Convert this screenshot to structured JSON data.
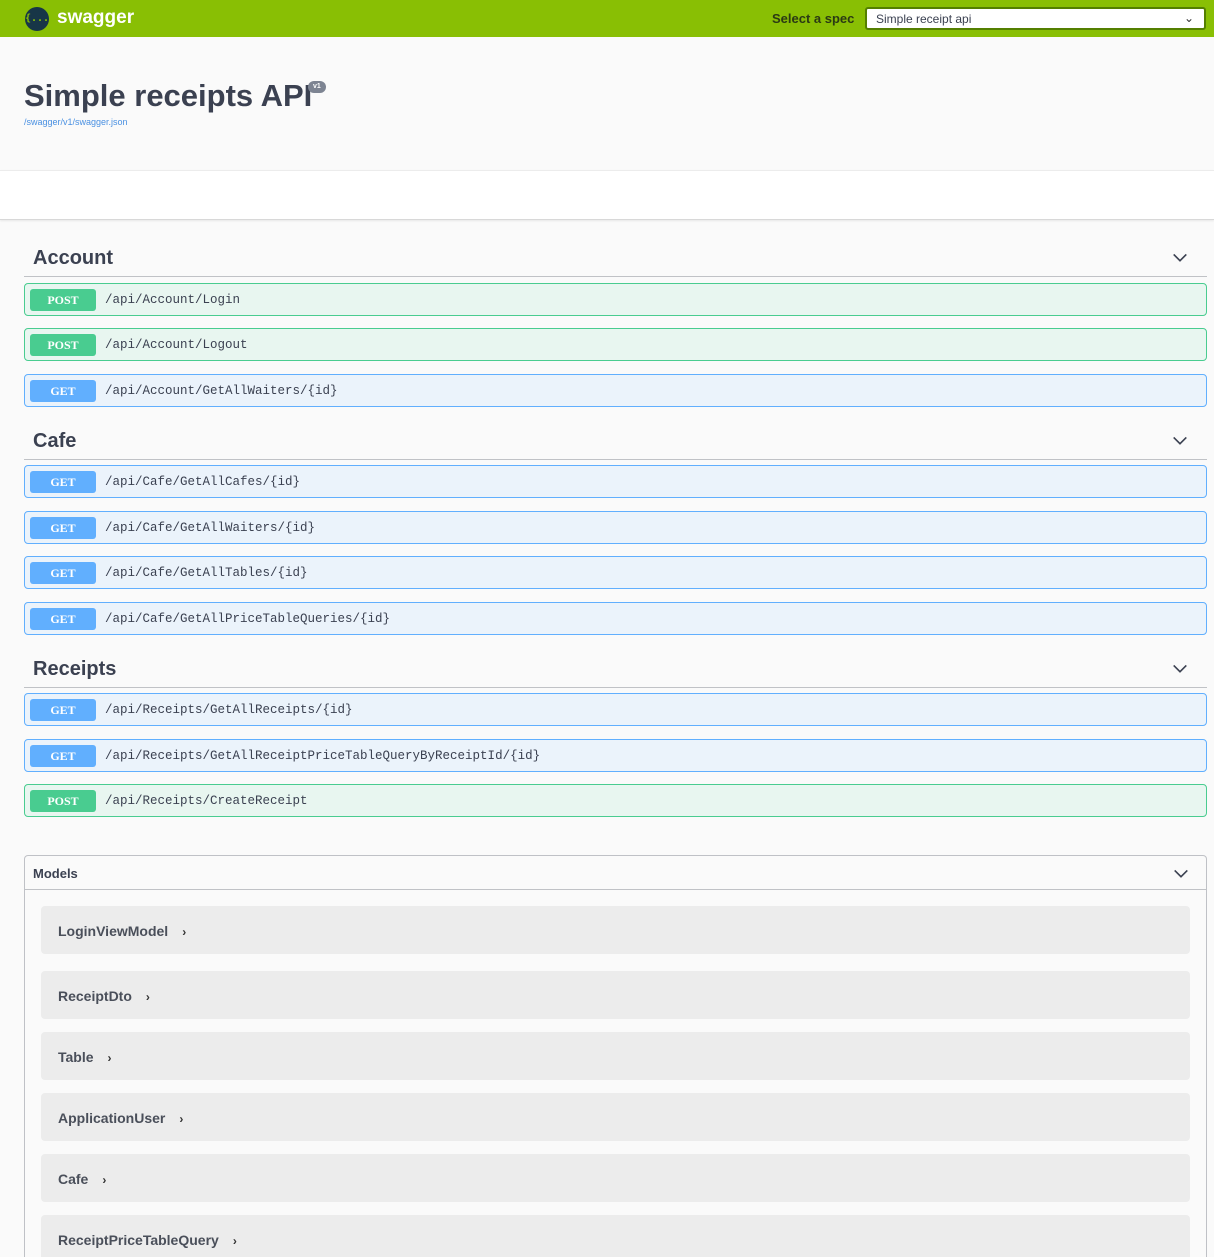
{
  "topbar": {
    "logo_glyph": "{...}",
    "logo_text": "swagger",
    "spec_label": "Select a spec",
    "spec_selected": "Simple receipt api",
    "chevron": "⌄"
  },
  "info": {
    "title": "Simple receipts API",
    "version": "v1",
    "spec_url": "/swagger/v1/swagger.json"
  },
  "tags": [
    {
      "name": "Account",
      "operations": [
        {
          "method": "POST",
          "path": "/api/Account/Login"
        },
        {
          "method": "POST",
          "path": "/api/Account/Logout"
        },
        {
          "method": "GET",
          "path": "/api/Account/GetAllWaiters/{id}"
        }
      ]
    },
    {
      "name": "Cafe",
      "operations": [
        {
          "method": "GET",
          "path": "/api/Cafe/GetAllCafes/{id}"
        },
        {
          "method": "GET",
          "path": "/api/Cafe/GetAllWaiters/{id}"
        },
        {
          "method": "GET",
          "path": "/api/Cafe/GetAllTables/{id}"
        },
        {
          "method": "GET",
          "path": "/api/Cafe/GetAllPriceTableQueries/{id}"
        }
      ]
    },
    {
      "name": "Receipts",
      "operations": [
        {
          "method": "GET",
          "path": "/api/Receipts/GetAllReceipts/{id}"
        },
        {
          "method": "GET",
          "path": "/api/Receipts/GetAllReceiptPriceTableQueryByReceiptId/{id}"
        },
        {
          "method": "POST",
          "path": "/api/Receipts/CreateReceipt"
        }
      ]
    }
  ],
  "models": {
    "title": "Models",
    "items": [
      "LoginViewModel",
      "ReceiptDto",
      "Table",
      "ApplicationUser",
      "Cafe",
      "ReceiptPriceTableQuery"
    ],
    "arrow": "›"
  },
  "colors": {
    "topbar": "#89bf04",
    "post": "#49cc90",
    "get": "#61affe",
    "link": "#4990e2"
  }
}
